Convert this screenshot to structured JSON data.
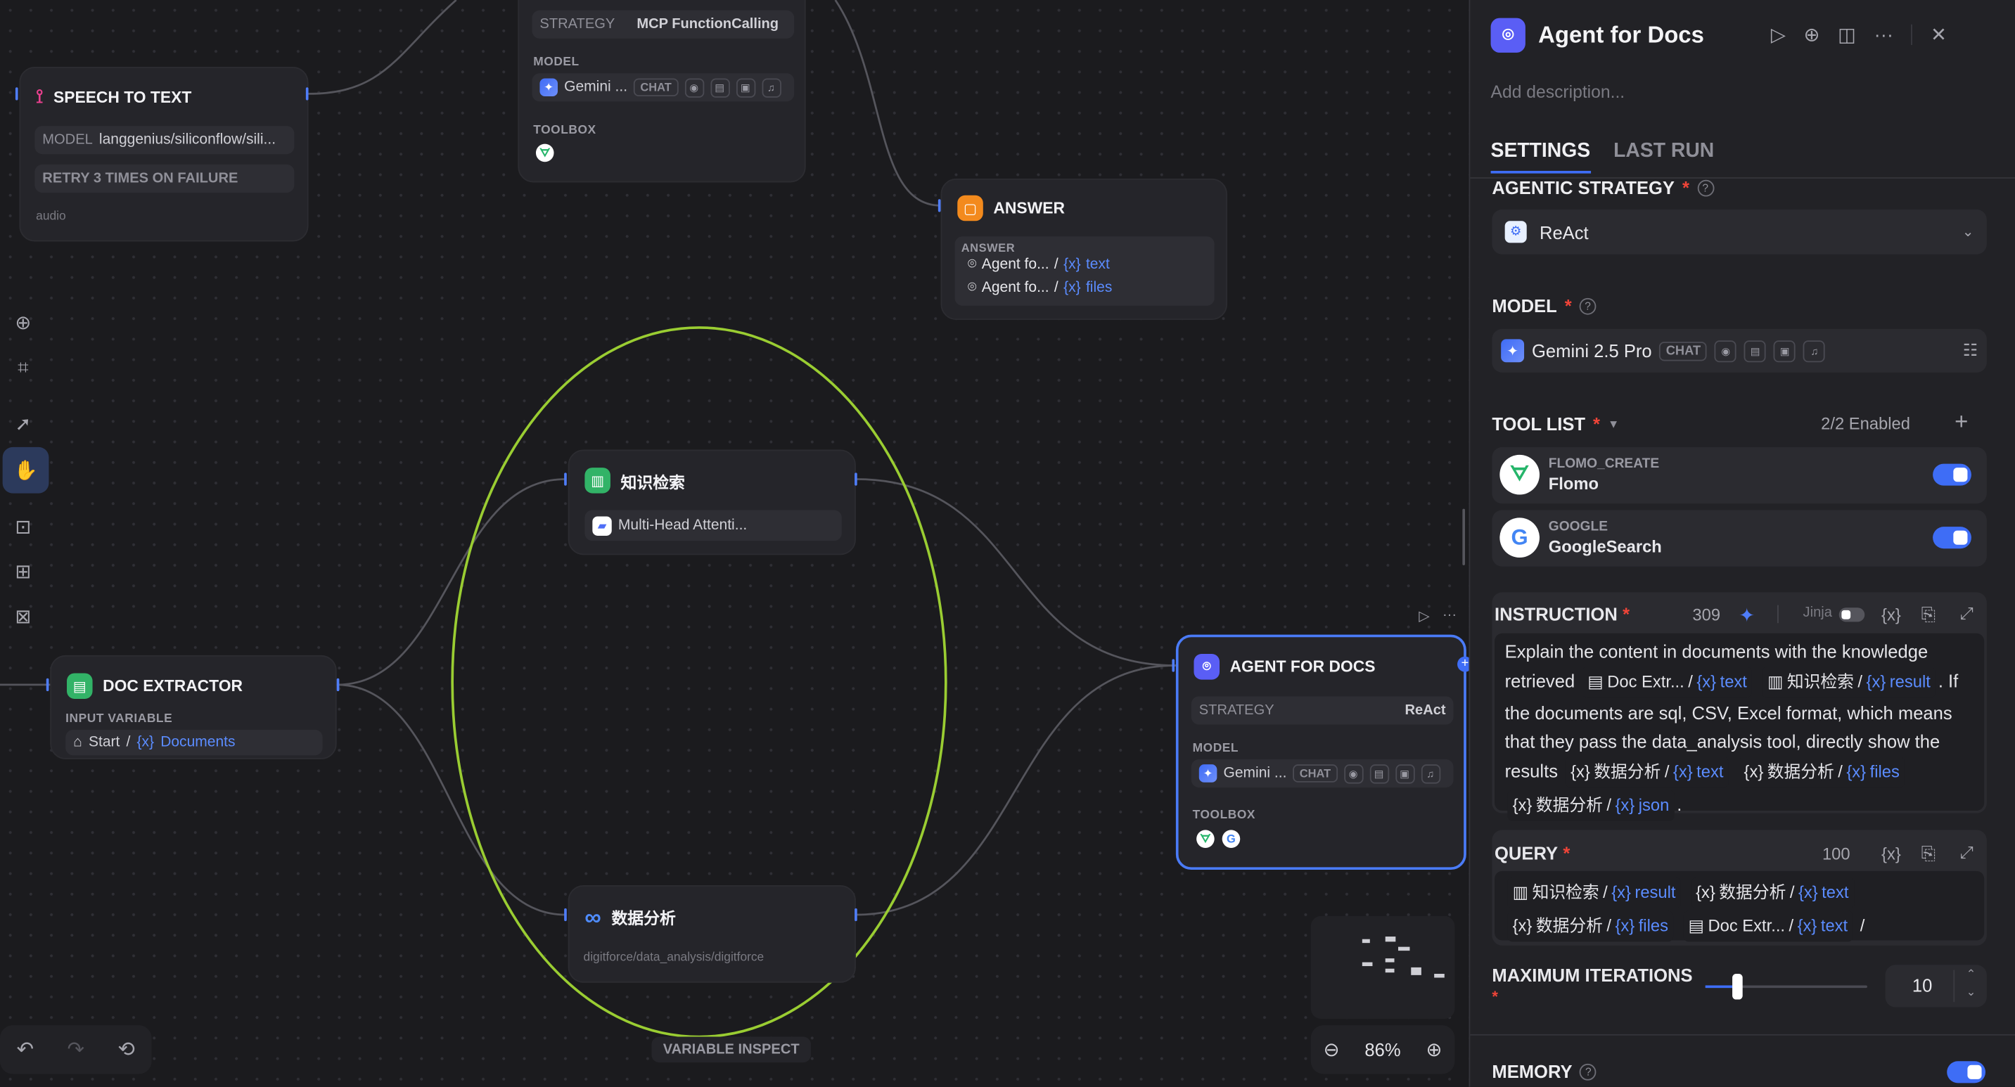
{
  "canvas": {
    "speech_node": {
      "title": "SPEECH TO TEXT",
      "model_label": "MODEL",
      "model_value": "langgenius/siliconflow/sili...",
      "retry": "RETRY 3 TIMES ON FAILURE",
      "footer": "audio"
    },
    "agent_top_node": {
      "strategy_label": "STRATEGY",
      "strategy_value": "MCP FunctionCalling",
      "model_label": "MODEL",
      "model_name": "Gemini ...",
      "model_tag": "CHAT",
      "toolbox_label": "TOOLBOX"
    },
    "answer_node": {
      "title": "ANSWER",
      "label": "ANSWER",
      "rows": [
        {
          "src": "Agent fo...",
          "sep": "/",
          "var": "text"
        },
        {
          "src": "Agent fo...",
          "sep": "/",
          "var": "files"
        }
      ]
    },
    "knowledge_node": {
      "title": "知识检索",
      "dataset": "Multi-Head Attenti..."
    },
    "data_node": {
      "title": "数据分析",
      "subtitle": "digitforce/data_analysis/digitforce"
    },
    "doc_node": {
      "title": "DOC EXTRACTOR",
      "label": "INPUT VARIABLE",
      "src": "Start",
      "sep": "/",
      "var": "Documents"
    },
    "agent_node": {
      "title": "AGENT FOR DOCS",
      "strategy_label": "STRATEGY",
      "strategy_value": "ReAct",
      "model_label": "MODEL",
      "model_name": "Gemini ...",
      "model_tag": "CHAT",
      "toolbox_label": "TOOLBOX"
    },
    "variable_inspect": "VARIABLE INSPECT",
    "zoom": "86%"
  },
  "panel": {
    "title": "Agent for Docs",
    "description_placeholder": "Add description...",
    "tabs": {
      "settings": "SETTINGS",
      "last_run": "LAST RUN"
    },
    "strategy": {
      "label": "AGENTIC STRATEGY",
      "value": "ReAct"
    },
    "model": {
      "label": "MODEL",
      "name": "Gemini 2.5 Pro",
      "tag": "CHAT"
    },
    "tools": {
      "label": "TOOL LIST",
      "status": "2/2 Enabled",
      "items": [
        {
          "provider": "FLOMO_CREATE",
          "name": "Flomo"
        },
        {
          "provider": "GOOGLE",
          "name": "GoogleSearch"
        }
      ]
    },
    "instruction": {
      "label": "INSTRUCTION",
      "count": "309",
      "jinja": "Jinja",
      "t1": "Explain the content in documents with the knowledge retrieved",
      "c1a": "Doc Extr...",
      "c1b": "text",
      "c2a": "知识检索",
      "c2b": "result",
      "t2": "If the documents are sql, CSV, Excel format, which means that they pass the data_analysis tool, directly show the results",
      "c3a": "数据分析",
      "c3b": "text",
      "c4a": "数据分析",
      "c4b": "files",
      "c5a": "数据分析",
      "c5b": "json"
    },
    "query": {
      "label": "QUERY",
      "count": "100",
      "q1a": "知识检索",
      "q1b": "result",
      "q2a": "数据分析",
      "q2b": "text",
      "q3a": "数据分析",
      "q3b": "files",
      "q4a": "Doc Extr...",
      "q4b": "text"
    },
    "max_iter": {
      "label": "MAXIMUM ITERATIONS",
      "value": "10",
      "fraction": 0.2
    },
    "memory": {
      "label": "MEMORY"
    }
  }
}
